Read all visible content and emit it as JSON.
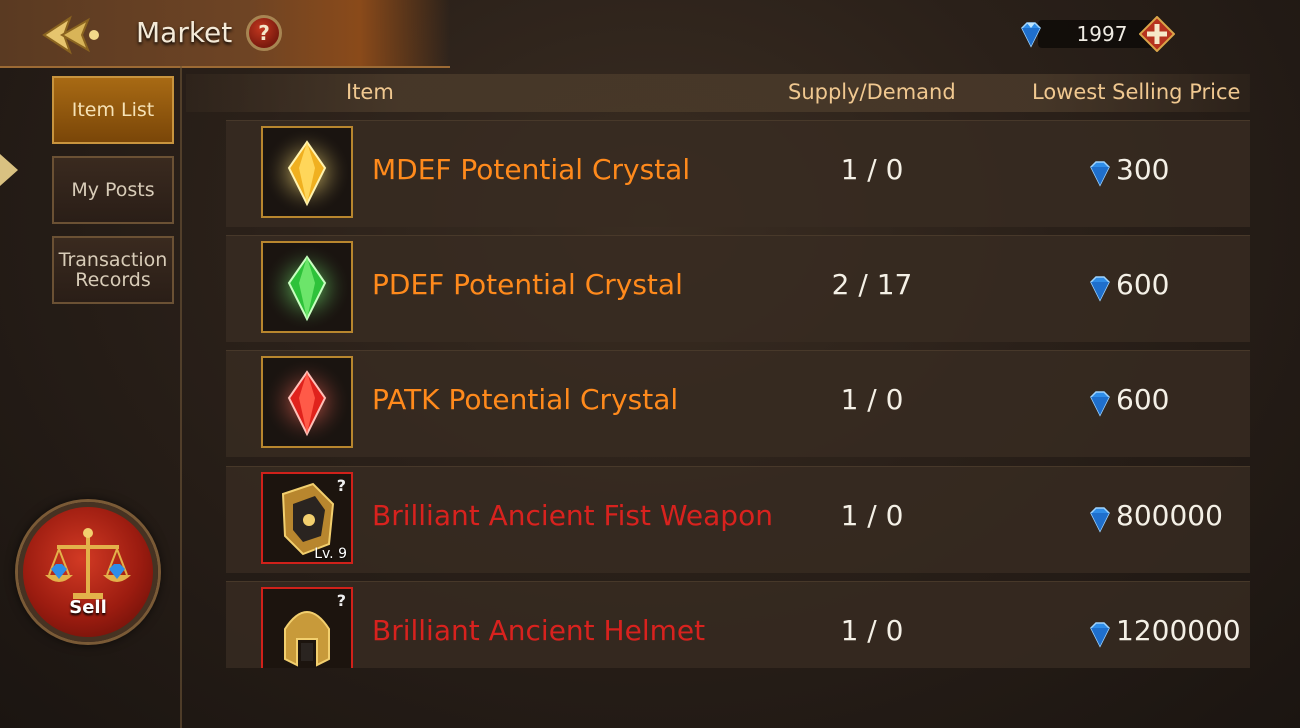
{
  "header": {
    "title": "Market",
    "help_label": "?",
    "currency_value": "1997",
    "add_label": "+"
  },
  "sidebar": {
    "items": [
      {
        "label": "Item List",
        "active": true
      },
      {
        "label": "My Posts",
        "active": false
      },
      {
        "label": "Transaction Records",
        "active": false
      }
    ],
    "sell_label": "Sell"
  },
  "table": {
    "columns": [
      "Item",
      "Supply/Demand",
      "Lowest Selling Price"
    ],
    "rows": [
      {
        "name": "MDEF Potential Crystal",
        "supply_demand": "1 / 0",
        "price": "300",
        "name_color": "orange",
        "icon": "gold-crystal-icon",
        "crystal_color": "#f0b020",
        "level": ""
      },
      {
        "name": "PDEF Potential Crystal",
        "supply_demand": "2 / 17",
        "price": "600",
        "name_color": "orange",
        "icon": "green-crystal-icon",
        "crystal_color": "#2ec23a",
        "level": ""
      },
      {
        "name": "PATK Potential Crystal",
        "supply_demand": "1 / 0",
        "price": "600",
        "name_color": "orange",
        "icon": "red-crystal-icon",
        "crystal_color": "#e0221c",
        "level": ""
      },
      {
        "name": "Brilliant Ancient Fist Weapon",
        "supply_demand": "1 / 0",
        "price": "800000",
        "name_color": "red",
        "icon": "fist-weapon-icon",
        "crystal_color": "",
        "level": "Lv. 9"
      },
      {
        "name": "Brilliant Ancient Helmet",
        "supply_demand": "1 / 0",
        "price": "1200000",
        "name_color": "red",
        "icon": "helmet-icon",
        "crystal_color": "",
        "level": ""
      }
    ]
  },
  "colors": {
    "accent_gold": "#d9a54a",
    "name_orange": "#ff8a1c",
    "name_red": "#d8221e",
    "gem_blue": "#2f8de8"
  }
}
